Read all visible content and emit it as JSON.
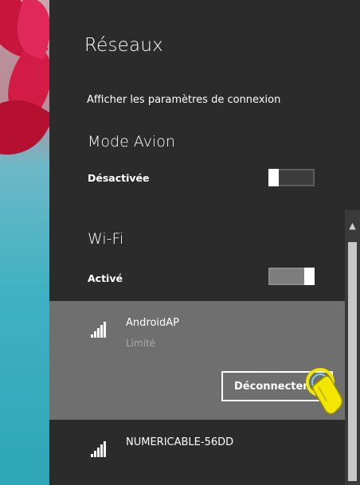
{
  "panel": {
    "title": "Réseaux",
    "settings_link": "Afficher les paramètres de connexion"
  },
  "airplane_mode": {
    "label": "Mode Avion",
    "state": "Désactivée",
    "on": false
  },
  "wifi": {
    "label": "Wi-Fi",
    "state": "Activé",
    "on": true
  },
  "networks": [
    {
      "name": "AndroidAP",
      "status": "Limité",
      "selected": true,
      "icon": "wifi-signal-icon"
    },
    {
      "name": "NUMERICABLE-56DD",
      "status": "",
      "selected": false,
      "icon": "wifi-signal-icon"
    }
  ],
  "disconnect_button": {
    "label": "Déconnecter"
  },
  "colors": {
    "panel_bg": "#2b2b2b",
    "selected_bg": "#6f6f6f",
    "text": "#ffffff",
    "muted_text": "#a9a9a9",
    "pointer_yellow": "#f3e600"
  }
}
